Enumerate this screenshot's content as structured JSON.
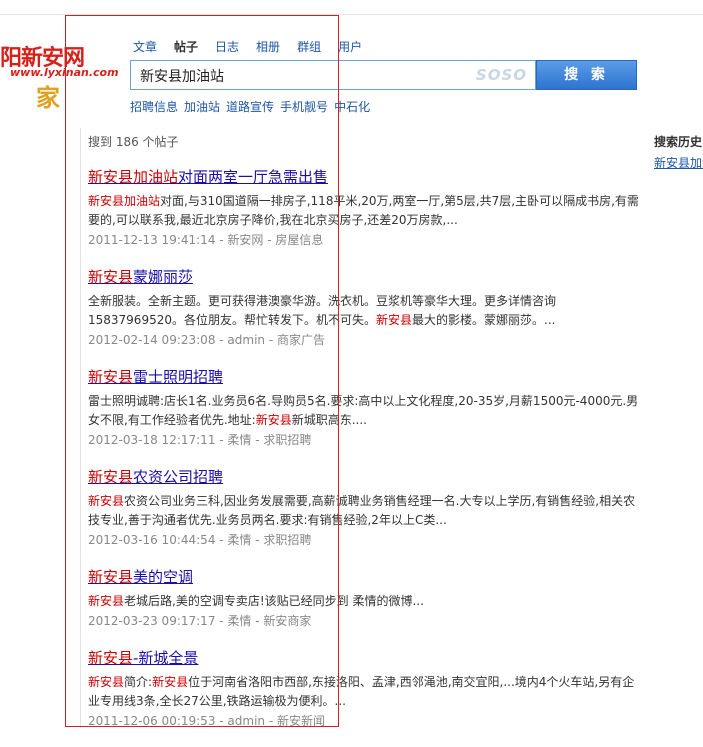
{
  "logo": {
    "main": "阳新安网",
    "sub": "www.lyxinan.com",
    "deco": "家"
  },
  "tabs": [
    {
      "label": "文章"
    },
    {
      "label": "帖子"
    },
    {
      "label": "日志"
    },
    {
      "label": "相册"
    },
    {
      "label": "群组"
    },
    {
      "label": "用户"
    }
  ],
  "search": {
    "value": "新安县加油站",
    "watermark": "SOSO",
    "button": "搜 索"
  },
  "suggestions": [
    "招聘信息",
    "加油站",
    "道路宣传",
    "手机靓号",
    "中石化"
  ],
  "result_count": "搜到 186 个帖子",
  "results": [
    {
      "title_hl": "新安县加油站",
      "title_rest": "对面两室一厅急需出售",
      "snip_hl": "新安县加油站",
      "snip_rest": "对面,与310国道隔一排房子,118平米,20万,两室一厅,第5层,共7层,主卧可以隔成书房,有需要的,可以联系我,最近北京房子降价,我在北京买房子,还差20万房款,...",
      "meta": "2011-12-13 19:41:14 - 新安网 - 房屋信息"
    },
    {
      "title_hl": "新安县",
      "title_rest": "蒙娜丽莎",
      "snip_pre": "全新服装。全新主题。更可获得港澳豪华游。洗衣机。豆浆机等豪华大理。更多详情咨询15837969520。各位朋友。帮忙转发下。机不可失。",
      "snip_hl": "新安县",
      "snip_post": "最大的影楼。蒙娜丽莎。...",
      "meta": "2012-02-14 09:23:08 - admin - 商家广告"
    },
    {
      "title_hl": "新安县",
      "title_rest": "雷士照明招聘",
      "snip_pre": "雷士照明诚聘:店长1名.业务员6名.导购员5名.要求:高中以上文化程度,20-35岁,月薪1500元-4000元.男女不限,有工作经验者优先.地址:",
      "snip_hl": "新安县",
      "snip_post": "新城职高东....",
      "meta": "2012-03-18 12:17:11 - 柔情 - 求职招聘"
    },
    {
      "title_hl": "新安县",
      "title_rest": "农资公司招聘",
      "snip_hl": "新安县",
      "snip_rest": "农资公司业务三科,因业务发展需要,高薪诚聘业务销售经理一名.大专以上学历,有销售经验,相关农技专业,善于沟通者优先.业务员两名.要求:有销售经验,2年以上C类...",
      "meta": "2012-03-16 10:44:54 - 柔情 - 求职招聘"
    },
    {
      "title_hl": "新安县",
      "title_rest": "美的空调",
      "snip_hl": "新安县",
      "snip_rest": "老城后路,美的空调专卖店!该贴已经同步到 柔情的微博...",
      "meta": "2012-03-23 09:17:17 - 柔情 - 新安商家"
    },
    {
      "title_hl": "新安县",
      "title_rest": "-新城全景",
      "snip_hl": "新安县",
      "snip_mid": "简介:",
      "snip_hl2": "新安县",
      "snip_post": "位于河南省洛阳市西部,东接洛阳、孟津,西邻渑池,南交宜阳,...境内4个火车站,另有企业专用线3条,全长27公里,铁路运输极为便利。...",
      "meta": "2011-12-06 00:19:53 - admin - 新安新闻"
    }
  ],
  "history": {
    "title": "搜索历史",
    "item": "新安县加油站"
  },
  "colors": {
    "accent": "#1d56a4",
    "highlight": "#cc0000",
    "frame": "#d0202a",
    "button": "#2e74cf"
  }
}
